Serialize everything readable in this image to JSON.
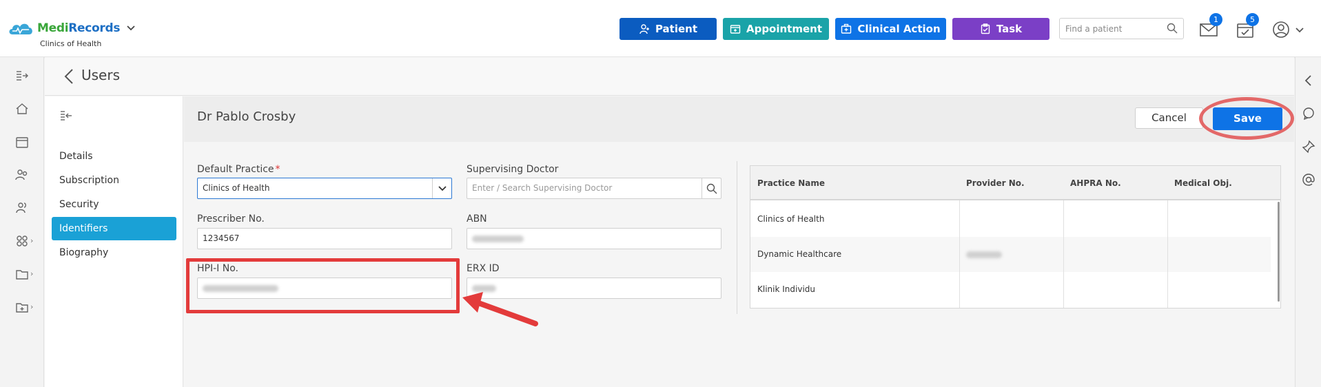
{
  "app": {
    "brand_part1": "Medi",
    "brand_part2": "Records",
    "practice_subtitle": "Clinics of Health"
  },
  "header": {
    "buttons": {
      "patient": "Patient",
      "appointment": "Appointment",
      "clinical_action": "Clinical Action",
      "task": "Task"
    },
    "search_placeholder": "Find a patient",
    "mail_count": "1",
    "tasks_count": "5"
  },
  "page": {
    "title": "Users"
  },
  "subnav": {
    "items": [
      "Details",
      "Subscription",
      "Security",
      "Identifiers",
      "Biography"
    ],
    "active": "Identifiers"
  },
  "form": {
    "doctor_name": "Dr Pablo Crosby",
    "cancel_label": "Cancel",
    "save_label": "Save",
    "default_practice_label": "Default Practice",
    "required_mark": "*",
    "default_practice_value": "Clinics of Health",
    "supervising_doctor_label": "Supervising Doctor",
    "supervising_doctor_placeholder": "Enter / Search Supervising Doctor",
    "prescriber_label": "Prescriber No.",
    "prescriber_value": "1234567",
    "abn_label": "ABN",
    "hpii_label": "HPI-I No.",
    "erx_label": "ERX ID"
  },
  "table": {
    "columns": [
      "Practice Name",
      "Provider No.",
      "AHPRA No.",
      "Medical Obj."
    ],
    "rows": [
      {
        "practice": "Clinics of Health"
      },
      {
        "practice": "Dynamic Healthcare"
      },
      {
        "practice": "Klinik Individu"
      }
    ]
  },
  "colors": {
    "patient_btn": "#0b5cc0",
    "appointment_btn": "#1aa3a8",
    "clinical_btn": "#0e73e6",
    "task_btn": "#7b3fc6",
    "active_nav": "#1aa1d6",
    "highlight": "#e33b3b"
  }
}
